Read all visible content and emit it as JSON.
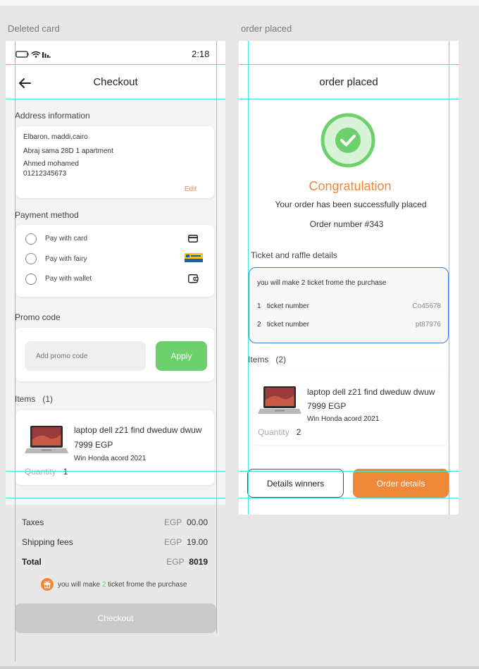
{
  "left": {
    "frame_label": "Deleted card",
    "status_time": "2:18",
    "title": "Checkout",
    "address": {
      "section_title": "Address information",
      "lines": [
        "Elbaron, maddi,cairo",
        "Abraj sama 28D 1 apartment",
        "Ahmed mohamed",
        "01212345673"
      ],
      "edit_label": "Edit"
    },
    "payment": {
      "section_title": "Payment method",
      "options": [
        "Pay with card",
        "Pay with fairy",
        "Pay with wallet"
      ]
    },
    "promo": {
      "section_title": "Promo code",
      "placeholder": "Add promo code",
      "apply_label": "Apply"
    },
    "items": {
      "section_title": "Items",
      "count": "(1)",
      "product_name": "laptop dell z21 find dweduw dwuw",
      "price": "7999 EGP",
      "subtitle": "Win Honda acord 2021",
      "quantity_label": "Quantity",
      "quantity_value": "1"
    },
    "summary": {
      "taxes_label": "Taxes",
      "taxes_currency": "EGP",
      "taxes_value": "00.00",
      "shipping_label": "Shipping fees",
      "shipping_currency": "EGP",
      "shipping_value": "19.00",
      "total_label": "Total",
      "total_currency": "EGP",
      "total_value": "8019",
      "ticket_note_prefix": "you will make",
      "ticket_note_count": "2",
      "ticket_note_suffix": "ticket frome the purchase"
    },
    "checkout_label": "Checkout"
  },
  "right": {
    "frame_label": "order placed",
    "title": "order placed",
    "congrats": "Congratulation",
    "success_msg": "Your order has been successfully placed",
    "order_number": "Order number  #343",
    "ticket": {
      "section_title": "Ticket and raffle details",
      "note": "you will make 2 ticket frome the purchase",
      "rows": [
        {
          "idx": "1",
          "label": "ticket number",
          "code": "Co45678"
        },
        {
          "idx": "2",
          "label": "ticket number",
          "code": "pt87976"
        }
      ]
    },
    "items": {
      "section_title": "Items",
      "count": "(2)",
      "product_name": "laptop dell z21 find dweduw dwuw",
      "price": "7999 EGP",
      "subtitle": "Win Honda acord 2021",
      "quantity_label": "Quantity",
      "quantity_value": "2"
    },
    "details_winners_label": "Details winners",
    "order_details_label": "Order details"
  },
  "colors": {
    "accent_orange": "#f0883a",
    "accent_green": "#6cd06c",
    "guide_cyan": "#3ee6e6",
    "ticket_border": "#3a7fd5"
  }
}
